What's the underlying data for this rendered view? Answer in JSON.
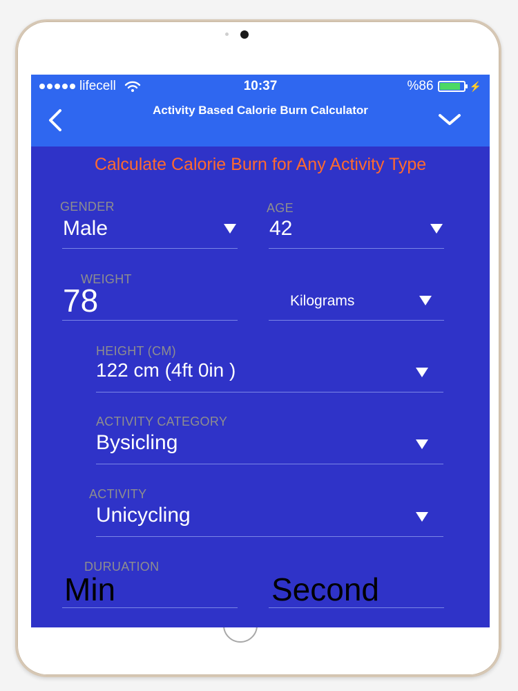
{
  "status": {
    "carrier": "lifecell",
    "time": "10:37",
    "battery_text": "%86",
    "battery_level": 0.86
  },
  "nav": {
    "title": "Activity Based Calorie Burn Calculator"
  },
  "headline": "Calculate Calorie Burn for Any Activity Type",
  "form": {
    "gender": {
      "label": "GENDER",
      "value": "Male"
    },
    "age": {
      "label": "AGE",
      "value": "42"
    },
    "weight": {
      "label": "WEIGHT",
      "value": "78",
      "unit": "Kilograms"
    },
    "height": {
      "label": "HEIGHT (CM)",
      "value": "122 cm (4ft 0in )"
    },
    "activity_category": {
      "label": "ACTIVITY CATEGORY",
      "value": "Bysicling"
    },
    "activity": {
      "label": "ACTIVITY",
      "value": "Unicycling"
    },
    "duration": {
      "label": "DURUATION",
      "min_placeholder": "Min",
      "second_placeholder": "Second"
    }
  },
  "colors": {
    "screen_bg": "#2f33c8",
    "bar_bg": "#2f67f0",
    "accent_orange": "#ff6a2e",
    "label_gray": "#8e8e8e"
  }
}
